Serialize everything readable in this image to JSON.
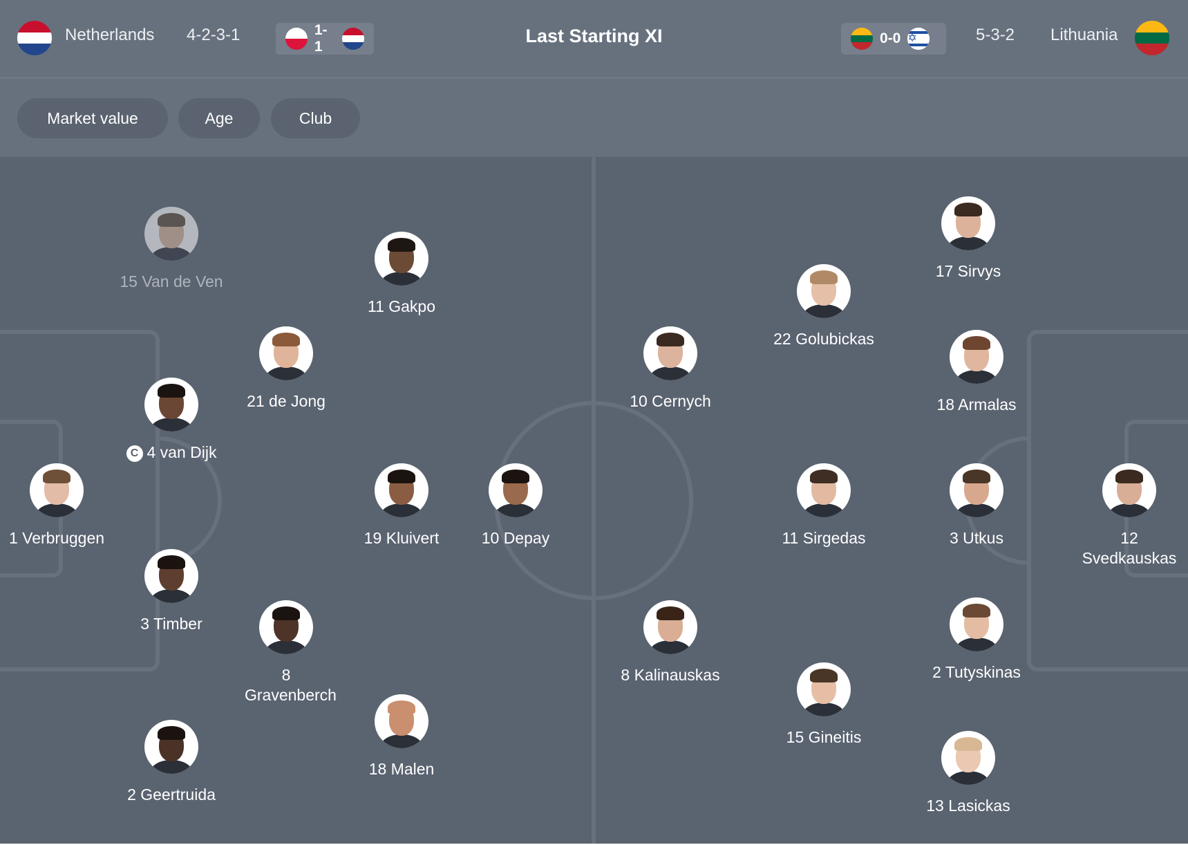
{
  "header": {
    "title": "Last Starting XI",
    "home": {
      "name": "Netherlands",
      "formation": "4-2-3-1",
      "flag_colors": [
        "#c8102e",
        "#ffffff",
        "#21468b"
      ],
      "flag_icon": "netherlands-flag-icon",
      "last_match": {
        "score": "1-1",
        "team1_flag": [
          "#ffffff",
          "#dc143c"
        ],
        "team1_flag_icon": "poland-flag-icon",
        "team2_flag": [
          "#c8102e",
          "#ffffff",
          "#21468b"
        ],
        "team2_flag_icon": "netherlands-flag-icon"
      }
    },
    "away": {
      "name": "Lithuania",
      "formation": "5-3-2",
      "flag_colors": [
        "#fdb913",
        "#006a44",
        "#c1272d"
      ],
      "flag_icon": "lithuania-flag-icon",
      "last_match": {
        "score": "0-0",
        "team1_flag": [
          "#fdb913",
          "#006a44",
          "#c1272d"
        ],
        "team1_flag_icon": "lithuania-flag-icon",
        "team2_flag": [
          "#ffffff",
          "#ffffff",
          "#ffffff"
        ],
        "team2_flag_icon": "israel-flag-icon",
        "team2_symbol": "✡"
      }
    }
  },
  "filters": [
    "Market value",
    "Age",
    "Club"
  ],
  "colors": {
    "panel": "#5a6370",
    "header": "#67717e",
    "pitch_lines": "#67707c",
    "text": "#ffffff",
    "substitute_text": "#aeb4bd"
  },
  "home_players": [
    {
      "label": "15 Van de Ven",
      "substitute": true,
      "captain": false,
      "skin": "#d9b39a",
      "hair": "#5a4a3c"
    },
    {
      "label": "11 Gakpo",
      "substitute": false,
      "captain": false,
      "skin": "#6b4a36",
      "hair": "#1e1612"
    },
    {
      "label": "21 de Jong",
      "substitute": false,
      "captain": false,
      "skin": "#e0b49a",
      "hair": "#8a5a3a"
    },
    {
      "label": "4 van Dijk",
      "substitute": false,
      "captain": true,
      "captain_mark": "C",
      "skin": "#6a4634",
      "hair": "#1b1310"
    },
    {
      "label": "1 Verbruggen",
      "substitute": false,
      "captain": false,
      "skin": "#e2bca6",
      "hair": "#6e5038"
    },
    {
      "label": "19 Kluivert",
      "substitute": false,
      "captain": false,
      "skin": "#8a5d43",
      "hair": "#1b1310"
    },
    {
      "label": "10 Depay",
      "substitute": false,
      "captain": false,
      "skin": "#9a6a4c",
      "hair": "#1b1310"
    },
    {
      "label": "3 Timber",
      "substitute": false,
      "captain": false,
      "skin": "#5e3f2f",
      "hair": "#1b1310"
    },
    {
      "label": "8 Gravenberch",
      "substitute": false,
      "captain": false,
      "skin": "#4e3428",
      "hair": "#1b1310"
    },
    {
      "label": "2 Geertruida",
      "substitute": false,
      "captain": false,
      "skin": "#4a3226",
      "hair": "#1b1310"
    },
    {
      "label": "18 Malen",
      "substitute": false,
      "captain": false,
      "skin": "#c98f6f",
      "hair": "#c98f6f"
    }
  ],
  "away_players": [
    {
      "label": "17 Sirvys",
      "substitute": false,
      "captain": false,
      "skin": "#dcb29a",
      "hair": "#3a2a20"
    },
    {
      "label": "22 Golubickas",
      "substitute": false,
      "captain": false,
      "skin": "#e6bfa8",
      "hair": "#b08a66"
    },
    {
      "label": "10 Cernych",
      "substitute": false,
      "captain": false,
      "skin": "#dcb39c",
      "hair": "#3a2a20"
    },
    {
      "label": "18 Armalas",
      "substitute": false,
      "captain": false,
      "skin": "#e0b69e",
      "hair": "#6e4630"
    },
    {
      "label": "11 Sirgedas",
      "substitute": false,
      "captain": false,
      "skin": "#e2baa2",
      "hair": "#3f2e24"
    },
    {
      "label": "3 Utkus",
      "substitute": false,
      "captain": false,
      "skin": "#d8a88e",
      "hair": "#4a3626"
    },
    {
      "label": "12 Svedkauskas",
      "substitute": false,
      "captain": false,
      "skin": "#d9ae96",
      "hair": "#3a2a20"
    },
    {
      "label": "8 Kalinauskas",
      "substitute": false,
      "captain": false,
      "skin": "#d9ae94",
      "hair": "#3a2418"
    },
    {
      "label": "2 Tutyskinas",
      "substitute": false,
      "captain": false,
      "skin": "#e4bca4",
      "hair": "#6a4a34"
    },
    {
      "label": "15 Gineitis",
      "substitute": false,
      "captain": false,
      "skin": "#e6bea6",
      "hair": "#4a3626"
    },
    {
      "label": "13 Lasickas",
      "substitute": false,
      "captain": false,
      "skin": "#eac8b2",
      "hair": "#d8b894"
    }
  ]
}
